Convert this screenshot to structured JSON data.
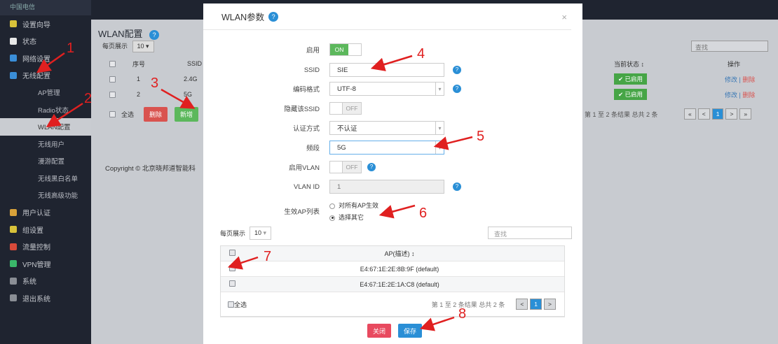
{
  "sidebar": {
    "logo": "中国电信",
    "items": [
      {
        "label": "设置向导",
        "color": "#d8c23a",
        "sub": false
      },
      {
        "label": "状态",
        "color": "#e8e8e8",
        "sub": false
      },
      {
        "label": "网络设置",
        "color": "#3a8ed8",
        "sub": false
      },
      {
        "label": "无线配置",
        "color": "#3a8ed8",
        "sub": false
      },
      {
        "label": "AP管理",
        "sub": true
      },
      {
        "label": "Radio状态",
        "sub": true
      },
      {
        "label": "WLAN配置",
        "sub": true,
        "active": true
      },
      {
        "label": "无线用户",
        "sub": true
      },
      {
        "label": "漫游配置",
        "sub": true
      },
      {
        "label": "无线黑白名单",
        "sub": true
      },
      {
        "label": "无线高级功能",
        "sub": true
      },
      {
        "label": "用户认证",
        "color": "#d8a23a",
        "sub": false
      },
      {
        "label": "组设置",
        "color": "#d8c23a",
        "sub": false
      },
      {
        "label": "流量控制",
        "color": "#d84a3a",
        "sub": false
      },
      {
        "label": "VPN管理",
        "color": "#3ab86a",
        "sub": false
      },
      {
        "label": "系统",
        "color": "#8a8e95",
        "sub": false
      },
      {
        "label": "退出系统",
        "color": "#8a8e95",
        "sub": false
      }
    ]
  },
  "bg": {
    "title": "WLAN配置",
    "per_page_label": "每页展示",
    "per_page_value": "10",
    "search_placeholder": "查找",
    "col_index": "序号",
    "col_ssid": "SSID",
    "col_status": "当前状态 ↕",
    "col_op": "操作",
    "rows": [
      {
        "index": "1",
        "ssid": "2.4G",
        "status": "✔ 已启用",
        "edit": "修改",
        "delete": "删除"
      },
      {
        "index": "2",
        "ssid": "5G",
        "status": "✔ 已启用",
        "edit": "修改",
        "delete": "删除"
      }
    ],
    "select_all": "全选",
    "delete_btn": "删除",
    "add_btn": "新增",
    "pager_summary": "第 1 至 2 条结果  总共 2 条",
    "pager": [
      "«",
      "<",
      "1",
      ">",
      "»"
    ],
    "copyright": "Copyright © 北京晓邦道智能科"
  },
  "modal": {
    "title": "WLAN参数",
    "close": "×",
    "enable_label": "启用",
    "enable_state": "ON",
    "ssid_label": "SSID",
    "ssid_value": "SIE",
    "encoding_label": "编码格式",
    "encoding_value": "UTF-8",
    "hide_ssid_label": "隐藏该SSID",
    "hide_ssid_state": "OFF",
    "auth_label": "认证方式",
    "auth_value": "不认证",
    "band_label": "频段",
    "band_value": "5G",
    "vlan_enable_label": "启用VLAN",
    "vlan_enable_state": "OFF",
    "vlan_id_label": "VLAN ID",
    "vlan_id_value": "1",
    "ap_list_label": "生效AP列表",
    "ap_opt_all": "对所有AP生效",
    "ap_opt_select": "选择其它",
    "per_page_label": "每页展示",
    "per_page_value": "10",
    "search_placeholder": "查找",
    "ap_header": "AP(描述) ↕",
    "ap_rows": [
      "E4:67:1E:2E:8B:9F (default)",
      "E4:67:1E:2E:1A:C8 (default)"
    ],
    "select_all": "全选",
    "pager_summary": "第 1 至 2 条结果  总共 2 条",
    "pager": [
      "<",
      "1",
      ">"
    ],
    "cancel_btn": "关闭",
    "save_btn": "保存"
  },
  "annotations": [
    "1",
    "2",
    "3",
    "4",
    "5",
    "6",
    "7",
    "8"
  ],
  "colors": {
    "accent": "#2a8fd6",
    "danger": "#e84a5f",
    "success": "#5cb85c",
    "annotation": "#e02020"
  }
}
